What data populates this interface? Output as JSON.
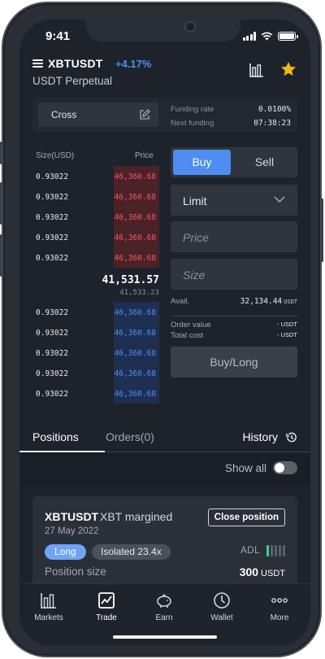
{
  "status_bar": {
    "time": "9:41"
  },
  "header": {
    "symbol": "XBTUSDT",
    "change": "+4.17%",
    "subtitle": "USDT Perpetual",
    "accent_color": "#4d8ef0",
    "star_color": "#f0b90b"
  },
  "info": {
    "margin_mode": "Cross",
    "funding_rate_label": "Funding rate",
    "funding_rate_value": "0.0100%",
    "next_funding_label": "Next funding",
    "next_funding_value": "07:38:23"
  },
  "orderbook": {
    "size_header": "Size(USD)",
    "price_header": "Price",
    "asks": [
      {
        "size": "0.93022",
        "price": "46,360.68"
      },
      {
        "size": "0.93022",
        "price": "46,360.68"
      },
      {
        "size": "0.93022",
        "price": "46,360.68"
      },
      {
        "size": "0.93022",
        "price": "46,360.68"
      },
      {
        "size": "0.93022",
        "price": "46,360.68"
      }
    ],
    "last_price": "41,531.57",
    "mark_price": "41,533.23",
    "bids": [
      {
        "size": "0.93022",
        "price": "46,360.68"
      },
      {
        "size": "0.93022",
        "price": "46,360.68"
      },
      {
        "size": "0.93022",
        "price": "46,360.68"
      },
      {
        "size": "0.93022",
        "price": "46,360.68"
      },
      {
        "size": "0.93022",
        "price": "46,360.68"
      }
    ],
    "ask_color": "#ee5a5f",
    "bid_color": "#4d8ef0"
  },
  "order_form": {
    "buy_label": "Buy",
    "sell_label": "Sell",
    "order_type": "Limit",
    "price_placeholder": "Price",
    "size_placeholder": "Size",
    "avail_label": "Avail.",
    "avail_value": "32,134.44",
    "avail_unit": "USDT",
    "order_value_label": "Order value",
    "order_value": "- USDT",
    "total_cost_label": "Total cost",
    "total_cost": "- USDT",
    "submit_label": "Buy/Long"
  },
  "tabs": {
    "positions": "Positions",
    "orders": "Orders(0)",
    "history": "History"
  },
  "filter": {
    "show_all_label": "Show all",
    "show_all_on": false
  },
  "position": {
    "symbol": "XBTUSDT",
    "margin_label": "XBT margined",
    "date": "27 May 2022",
    "close_label": "Close position",
    "side_badge": "Long",
    "mode_badge": "Isolated 23.4x",
    "adl_label": "ADL",
    "adl_level": 1,
    "adl_max": 5,
    "size_label": "Position size",
    "size_value": "300",
    "size_unit": "USDT"
  },
  "nav": [
    {
      "label": "Markets",
      "icon": "markets-icon"
    },
    {
      "label": "Trade",
      "icon": "trade-icon",
      "active": true
    },
    {
      "label": "Earn",
      "icon": "piggy-bank-icon"
    },
    {
      "label": "Wallet",
      "icon": "wallet-clock-icon"
    },
    {
      "label": "More",
      "icon": "more-dots-icon"
    }
  ]
}
